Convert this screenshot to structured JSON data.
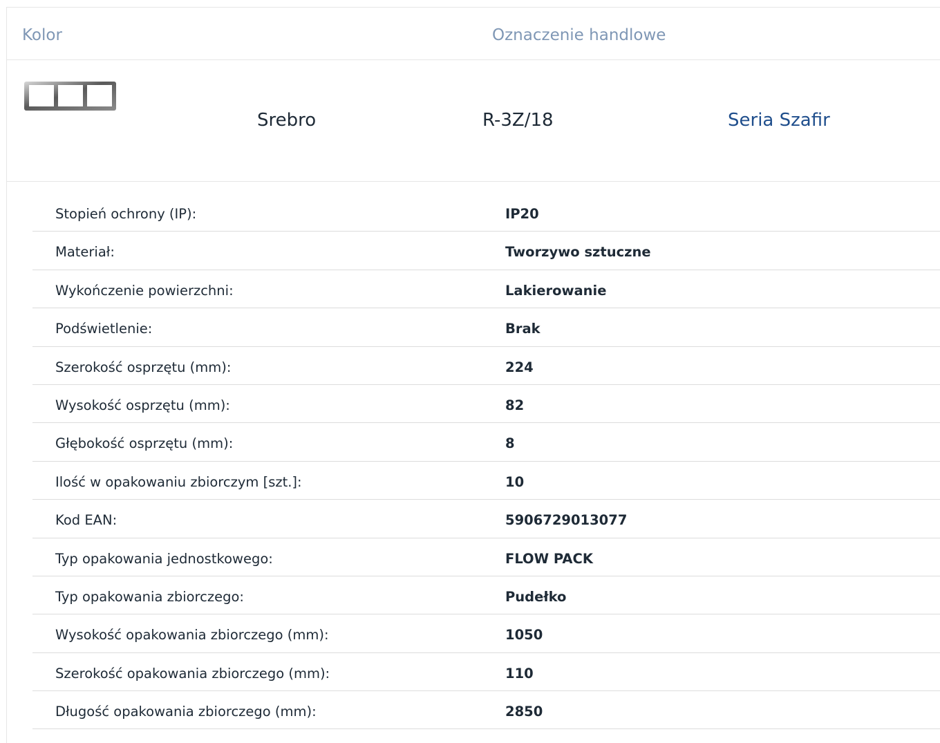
{
  "header": {
    "color_label": "Kolor",
    "trade_name_label": "Oznaczenie handlowe"
  },
  "product": {
    "icon": "three-gang-frame-icon",
    "color": "Srebro",
    "trade_name": "R-3Z/18",
    "series_link": "Seria Szafir"
  },
  "colors": {
    "header_text": "#7f97b5",
    "link": "#1f4e8c",
    "text": "#1e2a36",
    "divider": "#dcdcdc"
  },
  "specs": [
    {
      "label": "Stopień ochrony (IP):",
      "value": "IP20"
    },
    {
      "label": "Materiał:",
      "value": "Tworzywo sztuczne"
    },
    {
      "label": "Wykończenie powierzchni:",
      "value": "Lakierowanie"
    },
    {
      "label": "Podświetlenie:",
      "value": "Brak"
    },
    {
      "label": "Szerokość osprzętu (mm):",
      "value": "224"
    },
    {
      "label": "Wysokość osprzętu (mm):",
      "value": "82"
    },
    {
      "label": "Głębokość osprzętu (mm):",
      "value": "8"
    },
    {
      "label": "Ilość w opakowaniu zbiorczym [szt.]:",
      "value": "10"
    },
    {
      "label": "Kod EAN:",
      "value": "5906729013077"
    },
    {
      "label": "Typ opakowania jednostkowego:",
      "value": "FLOW PACK"
    },
    {
      "label": "Typ opakowania zbiorczego:",
      "value": "Pudełko"
    },
    {
      "label": "Wysokość opakowania zbiorczego (mm):",
      "value": "1050"
    },
    {
      "label": "Szerokość opakowania zbiorczego (mm):",
      "value": "110"
    },
    {
      "label": "Długość opakowania zbiorczego (mm):",
      "value": "2850"
    }
  ]
}
